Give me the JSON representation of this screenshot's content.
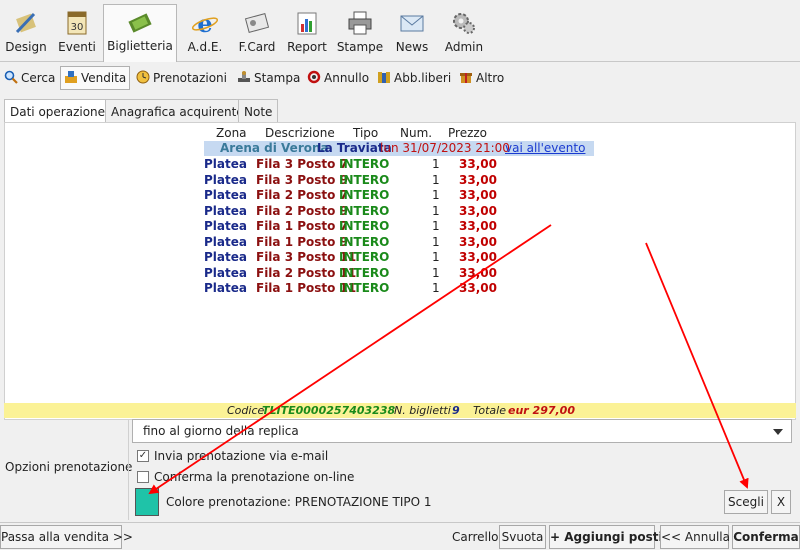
{
  "toolbar": {
    "items": [
      {
        "label": "Design",
        "icon": "pencil-ruler-icon"
      },
      {
        "label": "Eventi",
        "icon": "calendar-30-icon"
      },
      {
        "label": "Biglietteria",
        "icon": "ticket-icon"
      },
      {
        "label": "A.d.E.",
        "icon": "internet-explorer-icon"
      },
      {
        "label": "F.Card",
        "icon": "card-icon"
      },
      {
        "label": "Report",
        "icon": "bar-chart-icon"
      },
      {
        "label": "Stampe",
        "icon": "printer-icon"
      },
      {
        "label": "News",
        "icon": "envelope-icon"
      },
      {
        "label": "Admin",
        "icon": "gears-icon"
      }
    ]
  },
  "subbar": {
    "items": [
      {
        "label": "Cerca",
        "icon": "magnifier-icon"
      },
      {
        "label": "Vendita",
        "icon": "hand-sale-icon"
      },
      {
        "label": "Prenotazioni",
        "icon": "clock-icon"
      },
      {
        "label": "Stampa",
        "icon": "stamp-icon"
      },
      {
        "label": "Annullo",
        "icon": "undo-icon"
      },
      {
        "label": "Abb.liberi",
        "icon": "tickets-icon"
      },
      {
        "label": "Altro",
        "icon": "gift-icon"
      }
    ]
  },
  "tabs": [
    "Dati operazione",
    "Anagrafica acquirente",
    "Note"
  ],
  "table": {
    "headers": {
      "zona": "Zona",
      "descrizione": "Descrizione",
      "tipo": "Tipo",
      "num": "Num.",
      "prezzo": "Prezzo"
    },
    "event": {
      "venue": "Arena di Verona",
      "title": "La Traviata",
      "datetime": "lun 31/07/2023 21:00",
      "link": "vai all'evento"
    },
    "rows": [
      {
        "zona": "Platea",
        "descrizione": "Fila 3 Posto 7",
        "tipo": "INTERO",
        "num": "1",
        "prezzo": "33,00"
      },
      {
        "zona": "Platea",
        "descrizione": "Fila 3 Posto 9",
        "tipo": "INTERO",
        "num": "1",
        "prezzo": "33,00"
      },
      {
        "zona": "Platea",
        "descrizione": "Fila 2 Posto 7",
        "tipo": "INTERO",
        "num": "1",
        "prezzo": "33,00"
      },
      {
        "zona": "Platea",
        "descrizione": "Fila 2 Posto 9",
        "tipo": "INTERO",
        "num": "1",
        "prezzo": "33,00"
      },
      {
        "zona": "Platea",
        "descrizione": "Fila 1 Posto 7",
        "tipo": "INTERO",
        "num": "1",
        "prezzo": "33,00"
      },
      {
        "zona": "Platea",
        "descrizione": "Fila 1 Posto 9",
        "tipo": "INTERO",
        "num": "1",
        "prezzo": "33,00"
      },
      {
        "zona": "Platea",
        "descrizione": "Fila 3 Posto 11",
        "tipo": "INTERO",
        "num": "1",
        "prezzo": "33,00"
      },
      {
        "zona": "Platea",
        "descrizione": "Fila 2 Posto 11",
        "tipo": "INTERO",
        "num": "1",
        "prezzo": "33,00"
      },
      {
        "zona": "Platea",
        "descrizione": "Fila 1 Posto 11",
        "tipo": "INTERO",
        "num": "1",
        "prezzo": "33,00"
      }
    ]
  },
  "summary": {
    "codice_label": "Codice",
    "codice_value": "TLITE0000257403238",
    "biglietti_label": "N. biglietti",
    "biglietti_value": "9",
    "totale_label": "Totale",
    "totale_value": "eur 297,00"
  },
  "options": {
    "section_label": "Opzioni prenotazione",
    "select_value": "fino al giorno della replica",
    "email_label": "Invia prenotazione via e-mail",
    "email_checked": true,
    "online_label": "Conferma la prenotazione on-line",
    "online_checked": false,
    "color_label": "Colore prenotazione: PRENOTAZIONE TIPO 1",
    "color_value": "#1fc3a8",
    "scegli_label": "Scegli",
    "clear_label": "X"
  },
  "bottom": {
    "passa_label": "Passa alla vendita >>",
    "carrello_label": "Carrello",
    "svuota_label": "Svuota",
    "aggiungi_label": "+ Aggiungi posti",
    "annulla_label": "<< Annulla",
    "conferma_label": "Conferma"
  },
  "colors": {
    "accent_arrow": "#ff0000",
    "summary_bg": "#fbf296",
    "event_bg": "#c6d9f1"
  }
}
